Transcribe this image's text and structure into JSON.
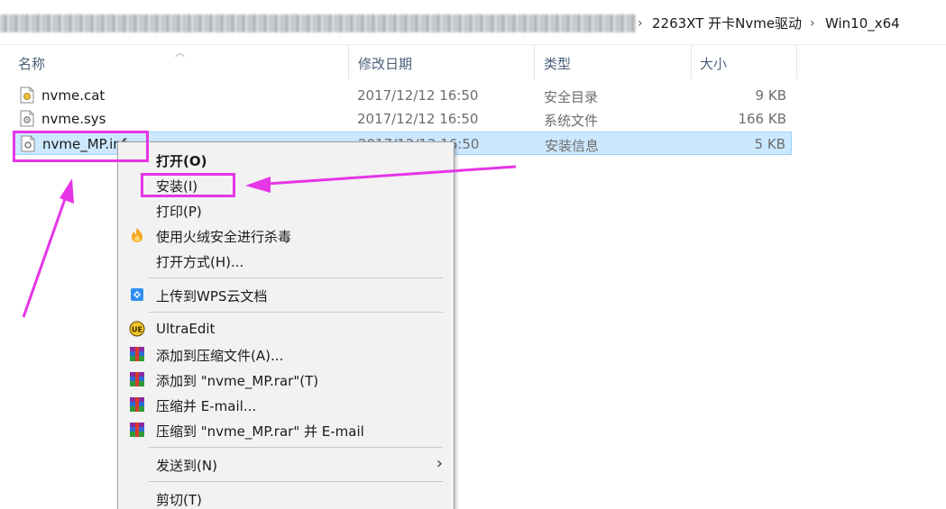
{
  "breadcrumb": {
    "items": [
      "2263XT 开卡Nvme驱动",
      "Win10_x64"
    ],
    "separator": "›"
  },
  "columns": {
    "name": "名称",
    "date": "修改日期",
    "type": "类型",
    "size": "大小"
  },
  "files": [
    {
      "name": "nvme.cat",
      "date": "2017/12/12 16:50",
      "type": "安全目录",
      "size": "9 KB",
      "icon": "security-catalog-icon"
    },
    {
      "name": "nvme.sys",
      "date": "2017/12/12 16:50",
      "type": "系统文件",
      "size": "166 KB",
      "icon": "system-file-icon"
    },
    {
      "name": "nvme_MP.inf",
      "date": "2017/12/12 16:50",
      "type": "安装信息",
      "size": "5 KB",
      "icon": "setup-info-icon",
      "selected": true
    }
  ],
  "context_menu": {
    "open": "打开(O)",
    "install": "安装(I)",
    "print": "打印(P)",
    "antivirus": "使用火绒安全进行杀毒",
    "open_with": "打开方式(H)...",
    "upload_wps": "上传到WPS云文档",
    "ultraedit": "UltraEdit",
    "add_archive": "添加到压缩文件(A)...",
    "add_rar": "添加到 \"nvme_MP.rar\"(T)",
    "compress_email": "压缩并 E-mail...",
    "compress_rar_email": "压缩到 \"nvme_MP.rar\" 并 E-mail",
    "send_to": "发送到(N)",
    "cut": "剪切(T)"
  },
  "colors": {
    "annotation": "#e535e5",
    "selection": "#cce8ff",
    "header_text": "#4c607a"
  }
}
